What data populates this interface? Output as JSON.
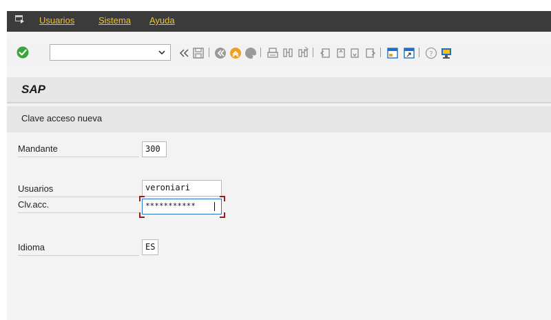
{
  "menu": {
    "items": [
      {
        "label": "Usuarios"
      },
      {
        "label": "Sistema"
      },
      {
        "label": "Ayuda"
      }
    ],
    "menu_icon": "menu-exit-icon"
  },
  "toolbar": {
    "command_field": {
      "value": "",
      "placeholder": ""
    },
    "icons": [
      "enter-check-icon",
      "dropdown-chevron-icon",
      "collapse-double-chevron-icon",
      "save-icon",
      "back-icon",
      "exit-icon",
      "cancel-icon",
      "print-icon",
      "find-icon",
      "find-next-icon",
      "first-page-icon",
      "previous-page-icon",
      "next-page-icon",
      "last-page-icon",
      "create-session-icon",
      "generate-shortcut-icon",
      "help-icon",
      "customize-layout-icon"
    ],
    "colors": {
      "enter": "#3aa53a",
      "exit": "#f0a020",
      "monitor": "#1f6fc4"
    }
  },
  "title": "SAP",
  "subtitle": "Clave acceso nueva",
  "form": {
    "mandante": {
      "label": "Mandante",
      "value": "300"
    },
    "usuario": {
      "label": "Usuarios",
      "value": "veroniari"
    },
    "clave": {
      "label": "Clv.acc.",
      "value": "***********"
    },
    "idioma": {
      "label": "Idioma",
      "value": "ES"
    }
  }
}
